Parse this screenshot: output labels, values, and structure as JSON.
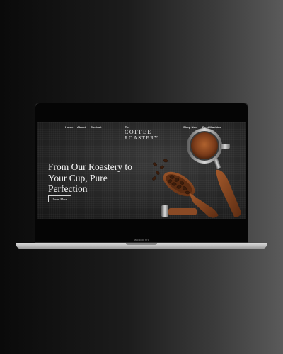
{
  "nav": {
    "left_links": [
      "Home",
      "About",
      "Contact"
    ],
    "right_links": [
      "Shop Now",
      "Best Machine"
    ]
  },
  "logo": {
    "line1": "The",
    "line2": "COFFEE",
    "line3": "ROASTERY"
  },
  "hero": {
    "headline": "From Our Roastery to Your Cup, Pure Perfection",
    "cta_label": "Learn More"
  },
  "device": {
    "model_label": "MacBook Pro"
  },
  "colors": {
    "background_dark": "#0a0a0a",
    "background_light": "#5a5a5a",
    "screen_bg": "#262626",
    "text_light": "#f4f4f4",
    "coffee_brown": "#5a2f18",
    "wood": "#8a4a25"
  }
}
